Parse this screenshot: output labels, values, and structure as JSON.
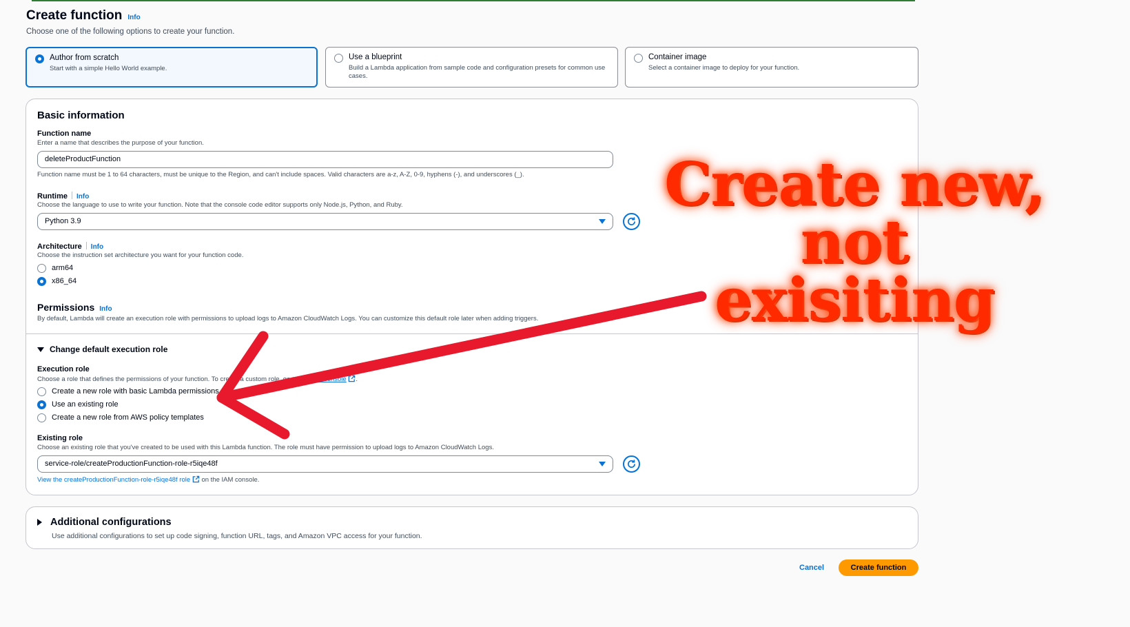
{
  "header": {
    "title": "Create function",
    "info": "Info",
    "subtitle": "Choose one of the following options to create your function."
  },
  "options": [
    {
      "title": "Author from scratch",
      "desc": "Start with a simple Hello World example.",
      "selected": true
    },
    {
      "title": "Use a blueprint",
      "desc": "Build a Lambda application from sample code and configuration presets for common use cases.",
      "selected": false
    },
    {
      "title": "Container image",
      "desc": "Select a container image to deploy for your function.",
      "selected": false
    }
  ],
  "basic": {
    "heading": "Basic information",
    "function_name": {
      "label": "Function name",
      "desc": "Enter a name that describes the purpose of your function.",
      "value": "deleteProductFunction",
      "constraint": "Function name must be 1 to 64 characters, must be unique to the Region, and can't include spaces. Valid characters are a-z, A-Z, 0-9, hyphens (-), and underscores (_)."
    },
    "runtime": {
      "label": "Runtime",
      "info": "Info",
      "desc": "Choose the language to use to write your function. Note that the console code editor supports only Node.js, Python, and Ruby.",
      "value": "Python 3.9"
    },
    "architecture": {
      "label": "Architecture",
      "info": "Info",
      "desc": "Choose the instruction set architecture you want for your function code.",
      "options": [
        "arm64",
        "x86_64"
      ],
      "selected": "x86_64"
    }
  },
  "permissions": {
    "heading": "Permissions",
    "info": "Info",
    "desc": "By default, Lambda will create an execution role with permissions to upload logs to Amazon CloudWatch Logs. You can customize this default role later when adding triggers.",
    "expander": "Change default execution role",
    "execution_role": {
      "label": "Execution role",
      "desc_prefix": "Choose a role that defines the permissions of your function. To create a custom role, go to the",
      "desc_link": "IAM console",
      "desc_suffix": ".",
      "options": [
        "Create a new role with basic Lambda permissions",
        "Use an existing role",
        "Create a new role from AWS policy templates"
      ],
      "selected": "Use an existing role"
    },
    "existing_role": {
      "label": "Existing role",
      "desc": "Choose an existing role that you've created to be used with this Lambda function. The role must have permission to upload logs to Amazon CloudWatch Logs.",
      "value": "service-role/createProductionFunction-role-r5iqe48f",
      "view_link": "View the createProductionFunction-role-r5iqe48f role",
      "view_suffix": "on the IAM console."
    }
  },
  "additional": {
    "heading": "Additional configurations",
    "desc": "Use additional configurations to set up code signing, function URL, tags, and Amazon VPC access for your function."
  },
  "footer": {
    "cancel": "Cancel",
    "create": "Create function"
  },
  "annotation": {
    "line1": "Create new, not",
    "line2": "exisiting",
    "color": "#ff2a00",
    "arrow_color": "#e8192c"
  },
  "colors": {
    "accent": "#0972d3",
    "primary_button": "#ff9900"
  }
}
